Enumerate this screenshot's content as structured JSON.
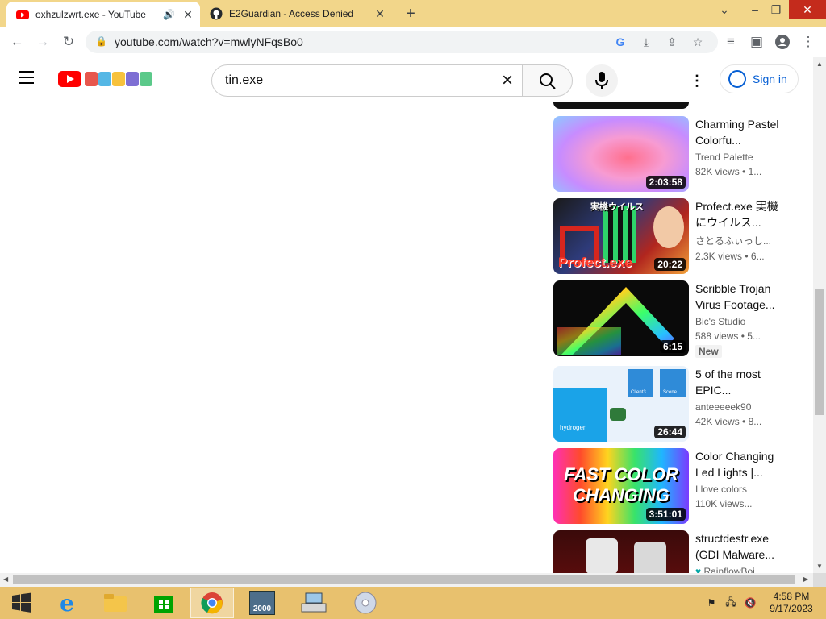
{
  "browser": {
    "tabs": [
      {
        "title": "oxhzulzwrt.exe - YouTube",
        "active": true
      },
      {
        "title": "E2Guardian - Access Denied",
        "active": false
      }
    ],
    "url": "youtube.com/watch?v=mwlyNFqsBo0"
  },
  "youtube": {
    "search_value": "tin.exe",
    "sign_in_label": "Sign in",
    "videos": [
      {
        "title": "Charming Pastel Colorfu...",
        "channel": "Trend Palette",
        "views": "82K views",
        "age": "• 1...",
        "duration": "2:03:58",
        "badge": ""
      },
      {
        "title": "Profect.exe 実機にウイルス...",
        "channel": "さとるふぃっし...",
        "views": "2.3K views",
        "age": "• 6...",
        "duration": "20:22",
        "badge": ""
      },
      {
        "title": "Scribble Trojan Virus Footage...",
        "channel": "Bic's Studio",
        "views": "588 views",
        "age": "• 5...",
        "duration": "6:15",
        "badge": "New"
      },
      {
        "title": "5 of the most EPIC...",
        "channel": "anteeeeek90",
        "views": "42K views",
        "age": "• 8...",
        "duration": "26:44",
        "badge": ""
      },
      {
        "title": "Color Changing Led Lights |...",
        "channel": "I love colors",
        "views": "110K views...",
        "age": "",
        "duration": "3:51:01",
        "badge": ""
      },
      {
        "title": "structdestr.exe (GDI Malware...",
        "channel": "RainflowBoi",
        "views": "",
        "age": "",
        "duration": "",
        "badge": ""
      }
    ],
    "thumb_texts": {
      "profect_top": "実機ウイルス",
      "profect_bottom": "Profect.exe",
      "fast_color_line1": "FAST COLOR",
      "fast_color_line2": "CHANGING",
      "epic_label1": "hydrogen",
      "epic_label2": "Client3",
      "epic_label3": "Scene"
    }
  },
  "taskbar": {
    "time": "4:58 PM",
    "date": "9/17/2023",
    "app_2000_label": "2000"
  },
  "colors": {
    "tab_strip": "#f2d68a",
    "taskbar": "#e8c16e",
    "yt_red": "#ff0000",
    "sign_in_blue": "#065fd4"
  }
}
